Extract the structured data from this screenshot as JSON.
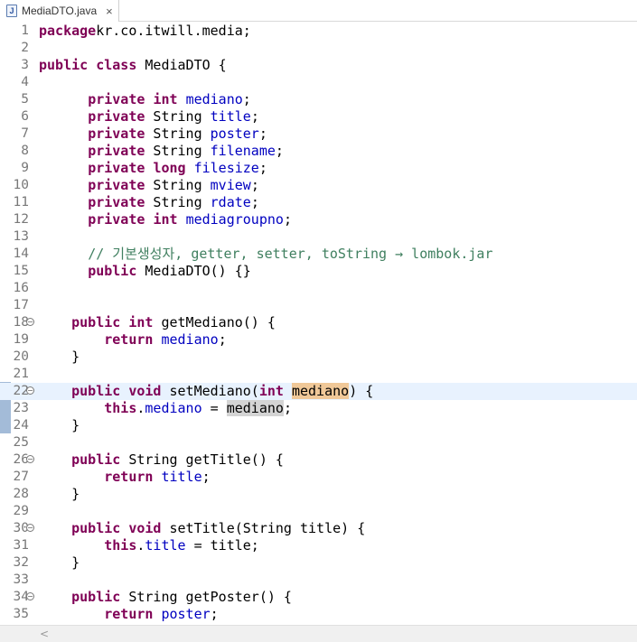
{
  "tab": {
    "label": "MediaDTO.java",
    "icon": "java-file-icon",
    "close": "×"
  },
  "lines": [
    {
      "n": "1",
      "t": [
        [
          "kw",
          "package"
        ],
        [
          "",
          "kr.co.itwill.media;"
        ]
      ]
    },
    {
      "n": "2",
      "t": []
    },
    {
      "n": "3",
      "t": [
        [
          "kw",
          "public"
        ],
        [
          "",
          " "
        ],
        [
          "kw",
          "class"
        ],
        [
          "",
          " MediaDTO {"
        ]
      ]
    },
    {
      "n": "4",
      "t": []
    },
    {
      "n": "5",
      "t": [
        [
          "",
          "      "
        ],
        [
          "kw",
          "private"
        ],
        [
          "",
          " "
        ],
        [
          "kw",
          "int"
        ],
        [
          "",
          " "
        ],
        [
          "fld",
          "mediano"
        ],
        [
          "",
          ";"
        ]
      ]
    },
    {
      "n": "6",
      "t": [
        [
          "",
          "      "
        ],
        [
          "kw",
          "private"
        ],
        [
          "",
          " String "
        ],
        [
          "fld",
          "title"
        ],
        [
          "",
          ";"
        ]
      ]
    },
    {
      "n": "7",
      "t": [
        [
          "",
          "      "
        ],
        [
          "kw",
          "private"
        ],
        [
          "",
          " String "
        ],
        [
          "fld",
          "poster"
        ],
        [
          "",
          ";"
        ]
      ]
    },
    {
      "n": "8",
      "t": [
        [
          "",
          "      "
        ],
        [
          "kw",
          "private"
        ],
        [
          "",
          " String "
        ],
        [
          "fld",
          "filename"
        ],
        [
          "",
          ";"
        ]
      ]
    },
    {
      "n": "9",
      "t": [
        [
          "",
          "      "
        ],
        [
          "kw",
          "private"
        ],
        [
          "",
          " "
        ],
        [
          "kw",
          "long"
        ],
        [
          "",
          " "
        ],
        [
          "fld",
          "filesize"
        ],
        [
          "",
          ";"
        ]
      ]
    },
    {
      "n": "10",
      "t": [
        [
          "",
          "      "
        ],
        [
          "kw",
          "private"
        ],
        [
          "",
          " String "
        ],
        [
          "fld",
          "mview"
        ],
        [
          "",
          ";"
        ]
      ]
    },
    {
      "n": "11",
      "t": [
        [
          "",
          "      "
        ],
        [
          "kw",
          "private"
        ],
        [
          "",
          " String "
        ],
        [
          "fld",
          "rdate"
        ],
        [
          "",
          ";"
        ]
      ]
    },
    {
      "n": "12",
      "t": [
        [
          "",
          "      "
        ],
        [
          "kw",
          "private"
        ],
        [
          "",
          " "
        ],
        [
          "kw",
          "int"
        ],
        [
          "",
          " "
        ],
        [
          "fld",
          "mediagroupno"
        ],
        [
          "",
          ";"
        ]
      ]
    },
    {
      "n": "13",
      "t": []
    },
    {
      "n": "14",
      "t": [
        [
          "",
          "      "
        ],
        [
          "cm",
          "// 기본생성자, getter, setter, toString → lombok.jar"
        ]
      ]
    },
    {
      "n": "15",
      "t": [
        [
          "",
          "      "
        ],
        [
          "kw",
          "public"
        ],
        [
          "",
          " MediaDTO() {}"
        ]
      ]
    },
    {
      "n": "16",
      "t": []
    },
    {
      "n": "17",
      "t": []
    },
    {
      "n": "18",
      "fold": true,
      "t": [
        [
          "",
          "    "
        ],
        [
          "kw",
          "public"
        ],
        [
          "",
          " "
        ],
        [
          "kw",
          "int"
        ],
        [
          "",
          " getMediano() {"
        ]
      ]
    },
    {
      "n": "19",
      "t": [
        [
          "",
          "        "
        ],
        [
          "kw",
          "return"
        ],
        [
          "",
          " "
        ],
        [
          "fld",
          "mediano"
        ],
        [
          "",
          ";"
        ]
      ]
    },
    {
      "n": "20",
      "t": [
        [
          "",
          "    }"
        ]
      ]
    },
    {
      "n": "21",
      "t": []
    },
    {
      "n": "22",
      "fold": true,
      "current": true,
      "t": [
        [
          "",
          "    "
        ],
        [
          "kw",
          "public"
        ],
        [
          "",
          " "
        ],
        [
          "kw",
          "void"
        ],
        [
          "",
          " setMediano("
        ],
        [
          "kw",
          "int"
        ],
        [
          "",
          " "
        ],
        [
          "occ-w",
          "media"
        ],
        [
          "caret",
          ""
        ],
        [
          "occ-w",
          "no"
        ],
        [
          "",
          ") {"
        ]
      ]
    },
    {
      "n": "23",
      "t": [
        [
          "",
          "        "
        ],
        [
          "kw",
          "this"
        ],
        [
          "",
          "."
        ],
        [
          "fld",
          "mediano"
        ],
        [
          "",
          " = "
        ],
        [
          "occ-r",
          "mediano"
        ],
        [
          "",
          ";"
        ]
      ]
    },
    {
      "n": "24",
      "t": [
        [
          "",
          "    }"
        ]
      ]
    },
    {
      "n": "25",
      "t": []
    },
    {
      "n": "26",
      "fold": true,
      "t": [
        [
          "",
          "    "
        ],
        [
          "kw",
          "public"
        ],
        [
          "",
          " String getTitle() {"
        ]
      ]
    },
    {
      "n": "27",
      "t": [
        [
          "",
          "        "
        ],
        [
          "kw",
          "return"
        ],
        [
          "",
          " "
        ],
        [
          "fld",
          "title"
        ],
        [
          "",
          ";"
        ]
      ]
    },
    {
      "n": "28",
      "t": [
        [
          "",
          "    }"
        ]
      ]
    },
    {
      "n": "29",
      "t": []
    },
    {
      "n": "30",
      "fold": true,
      "t": [
        [
          "",
          "    "
        ],
        [
          "kw",
          "public"
        ],
        [
          "",
          " "
        ],
        [
          "kw",
          "void"
        ],
        [
          "",
          " setTitle(String title) {"
        ]
      ]
    },
    {
      "n": "31",
      "t": [
        [
          "",
          "        "
        ],
        [
          "kw",
          "this"
        ],
        [
          "",
          "."
        ],
        [
          "fld",
          "title"
        ],
        [
          "",
          " = title;"
        ]
      ]
    },
    {
      "n": "32",
      "t": [
        [
          "",
          "    }"
        ]
      ]
    },
    {
      "n": "33",
      "t": []
    },
    {
      "n": "34",
      "fold": true,
      "t": [
        [
          "",
          "    "
        ],
        [
          "kw",
          "public"
        ],
        [
          "",
          " String getPoster() {"
        ]
      ]
    },
    {
      "n": "35",
      "t": [
        [
          "",
          "        "
        ],
        [
          "kw",
          "return"
        ],
        [
          "",
          " "
        ],
        [
          "fld",
          "poster"
        ],
        [
          "",
          ";"
        ]
      ]
    }
  ],
  "fold_symbol": "⊖",
  "scroll_left_arrow": "<"
}
